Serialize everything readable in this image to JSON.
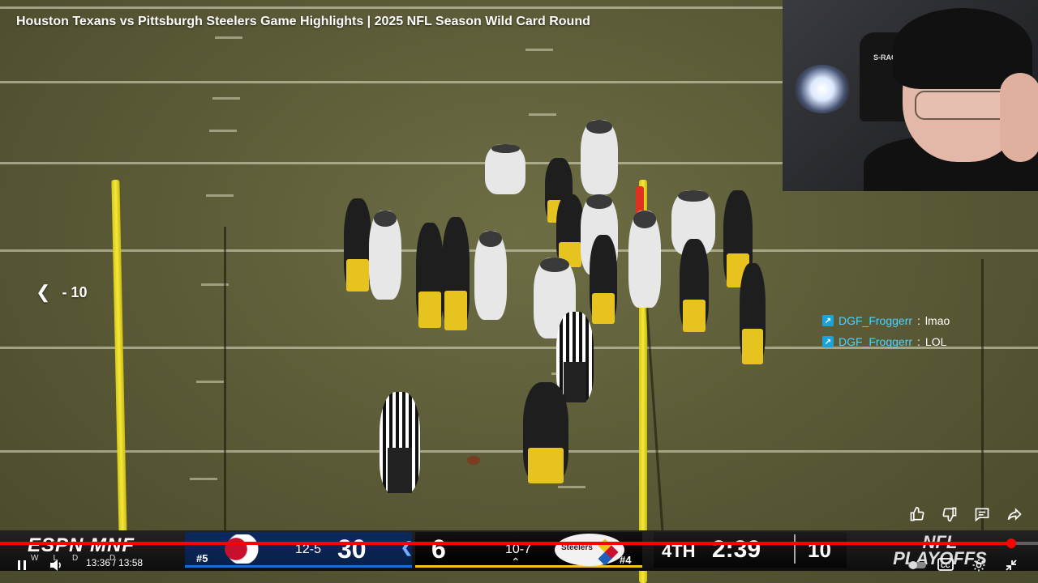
{
  "video": {
    "title": "Houston Texans vs Pittsburgh Steelers Game Highlights | 2025 NFL Season Wild Card Round",
    "seek_back_label": "- 10"
  },
  "webcam": {
    "chair_label": "S-RACER"
  },
  "chat": [
    {
      "user": "DGF_Froggerr",
      "separator": ":",
      "message": "lmao"
    },
    {
      "user": "DGF_Froggerr",
      "separator": ":",
      "message": "LOL"
    }
  ],
  "actions": {
    "like_icon": "thumbs-up-icon",
    "dislike_icon": "thumbs-down-icon",
    "comments_icon": "comment-icon",
    "share_icon": "share-icon"
  },
  "scorebug": {
    "network": "ESPN MNF",
    "network_sub": "WLD D",
    "home": {
      "seed": "#5",
      "record": "12-5",
      "score": "30",
      "logo": "texans-logo",
      "color": "#0b2a5c"
    },
    "away": {
      "seed": "#4",
      "record": "10-7",
      "score": "6",
      "name": "Steelers",
      "logo": "steelers-logo",
      "color": "#f0c419"
    },
    "quarter": "4TH",
    "clock": "2:39",
    "play_clock": "10",
    "event": "NFL PLAYOFFS"
  },
  "player": {
    "current_time": "13:36",
    "duration": "13:58",
    "time_separator": " / ",
    "progress": 0.974,
    "accent": "#ff0000"
  }
}
